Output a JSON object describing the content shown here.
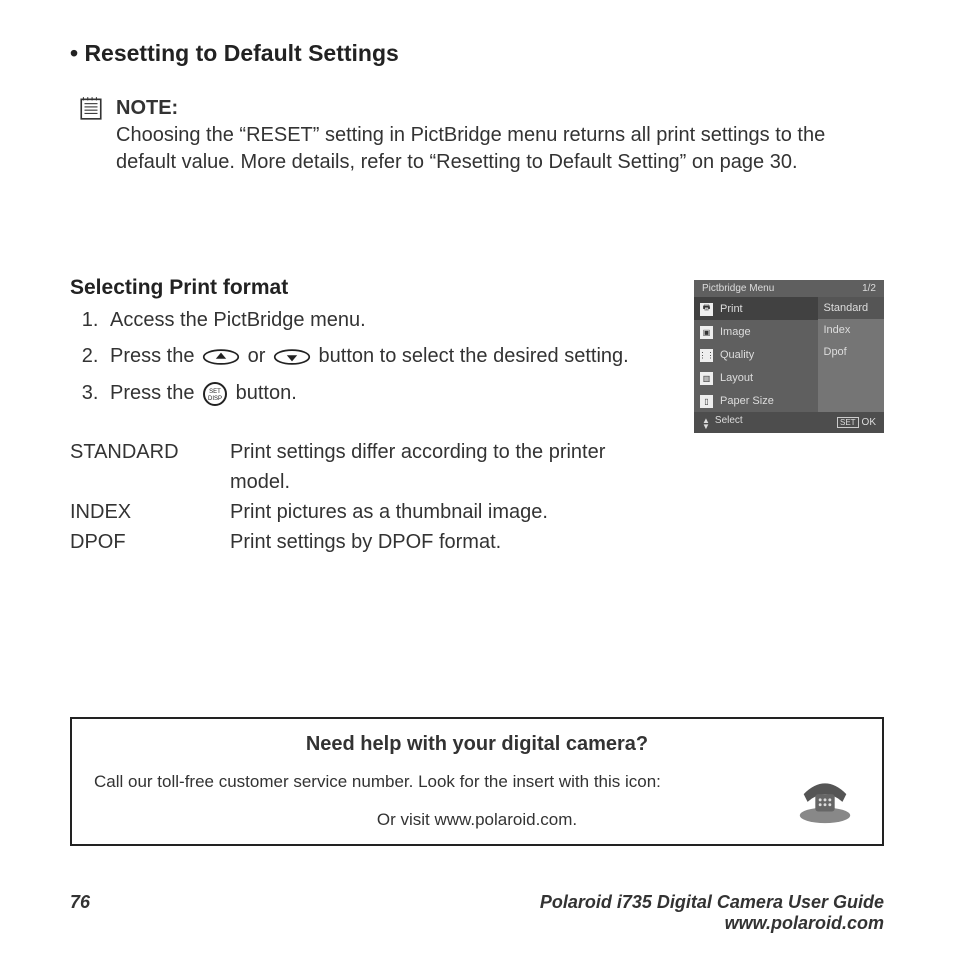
{
  "heading": "• Resetting to Default Settings",
  "note": {
    "label": "NOTE:",
    "body": "Choosing the “RESET” setting in PictBridge menu returns all print settings to the default value. More details, refer to “Resetting to Default Setting” on page 30."
  },
  "subheading": "Selecting Print format",
  "steps": {
    "s1": "Access the PictBridge menu.",
    "s2a": "Press the ",
    "s2or": " or ",
    "s2b": " button to select the desired setting.",
    "s3a": "Press the ",
    "s3b": " button."
  },
  "defs": [
    {
      "term": "STANDARD",
      "desc": "Print settings differ according to the printer model."
    },
    {
      "term": "INDEX",
      "desc": "Print pictures as a thumbnail image."
    },
    {
      "term": "DPOF",
      "desc": "Print settings by DPOF format."
    }
  ],
  "screen": {
    "title": "Pictbridge Menu",
    "page": "1/2",
    "left": [
      "Print",
      "Image",
      "Quality",
      "Layout",
      "Paper Size"
    ],
    "right": [
      "Standard",
      "Index",
      "Dpof"
    ],
    "footer_left": "Select",
    "footer_right": "OK"
  },
  "help": {
    "title": "Need help with your digital camera?",
    "line1": "Call our toll-free customer service number. Look for the insert with this icon:",
    "line2": "Or visit www.polaroid.com."
  },
  "footer": {
    "page": "76",
    "guide": "Polaroid i735 Digital Camera User Guide",
    "url": "www.polaroid.com"
  }
}
